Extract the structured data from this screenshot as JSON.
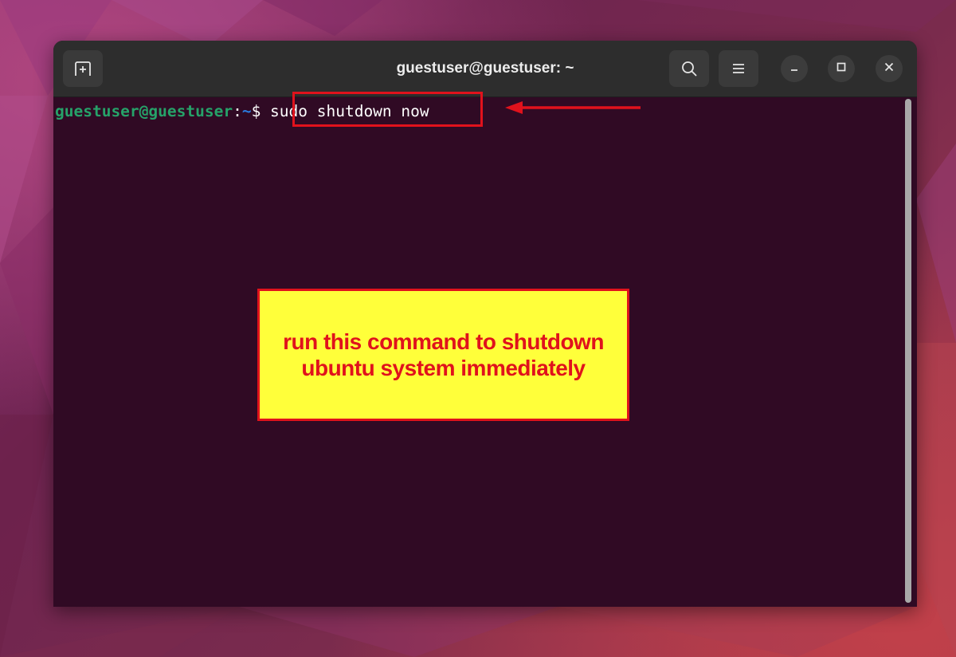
{
  "window": {
    "title": "guestuser@guestuser: ~"
  },
  "toolbar": {
    "new_tab_icon": "new-tab-icon",
    "search_icon": "search-icon",
    "menu_icon": "hamburger-menu-icon",
    "minimize_icon": "minimize-icon",
    "maximize_icon": "maximize-icon",
    "close_icon": "close-icon"
  },
  "terminal": {
    "prompt_user": "guestuser@guestuser",
    "prompt_colon": ":",
    "prompt_path": "~",
    "prompt_dollar": "$ ",
    "command": "sudo shutdown now"
  },
  "annotation": {
    "line1": "run this command to shutdown",
    "line2": "ubuntu system immediately"
  },
  "colors": {
    "terminal_bg": "#300a24",
    "header_bg": "#2d2d2d",
    "prompt_user": "#26a269",
    "prompt_path": "#2a7bde",
    "annotation_red": "#e0121c",
    "annotation_yellow": "#ffff3a"
  }
}
